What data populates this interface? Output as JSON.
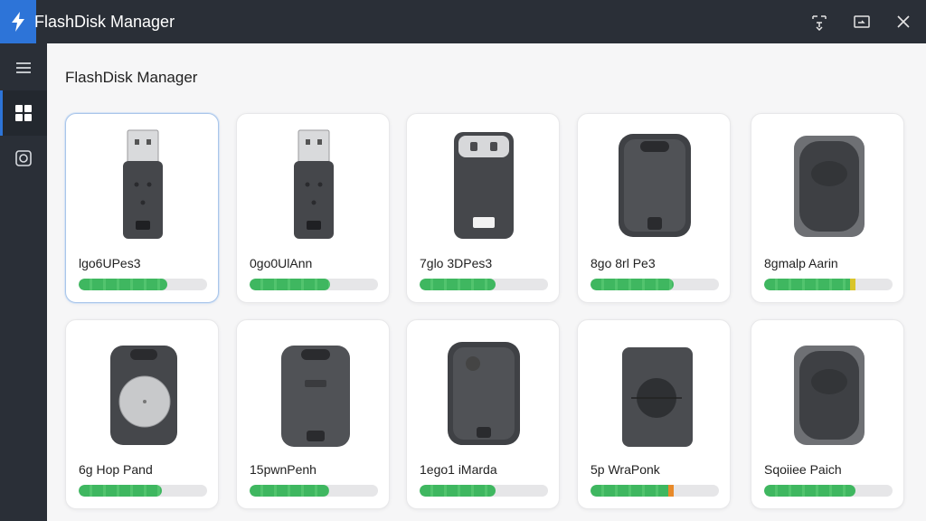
{
  "app": {
    "title": "FlashDisk Manager",
    "brand_color": "#2d74d8"
  },
  "window_controls": [
    {
      "name": "snap-icon"
    },
    {
      "name": "restore-icon"
    },
    {
      "name": "close-icon"
    }
  ],
  "sidebar": {
    "items": [
      {
        "icon": "menu-icon",
        "active": false
      },
      {
        "icon": "dashboard-icon",
        "active": true
      },
      {
        "icon": "settings-icon",
        "active": false
      }
    ]
  },
  "main": {
    "title": "FlashDisk Manager",
    "devices": [
      {
        "name": "Ɩgo6UPes3",
        "usage": 0.69,
        "style": "usb-a",
        "selected": true
      },
      {
        "name": "0go0UlAnn",
        "usage": 0.63,
        "style": "usb-a"
      },
      {
        "name": "7glo 3DPes3",
        "usage": 0.59,
        "style": "usb-c"
      },
      {
        "name": "8go 8rl Pe3",
        "usage": 0.65,
        "style": "rugged"
      },
      {
        "name": "8gmalp Aarin",
        "usage": 0.71,
        "style": "rugged-gray",
        "accent": "yellow"
      },
      {
        "name": "6g Hop Pand",
        "usage": 0.65,
        "style": "puck"
      },
      {
        "name": "15pwnPenh",
        "usage": 0.62,
        "style": "slim"
      },
      {
        "name": "1ego1 iMarda",
        "usage": 0.59,
        "style": "rugged"
      },
      {
        "name": "5p WraPonk",
        "usage": 0.65,
        "style": "dial",
        "accent": "orange"
      },
      {
        "name": "Sqoiiee Paich",
        "usage": 0.71,
        "style": "rugged-gray"
      }
    ]
  }
}
